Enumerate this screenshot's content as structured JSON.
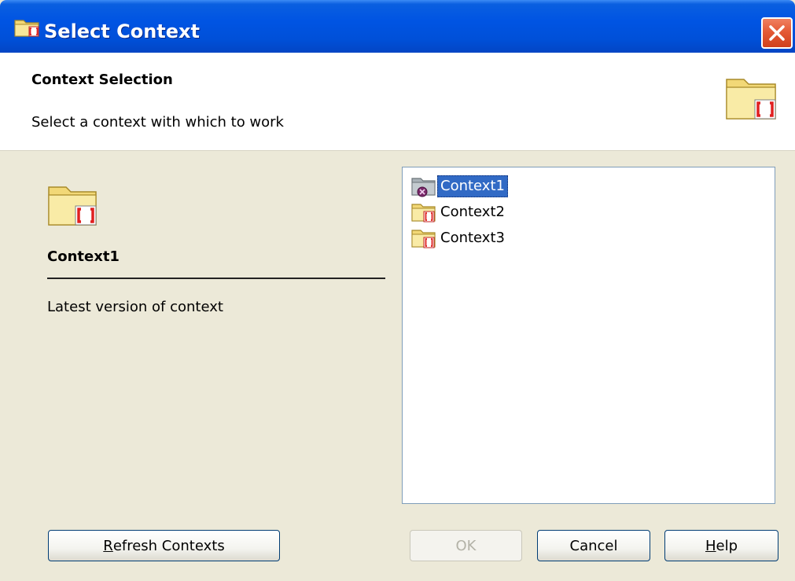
{
  "window": {
    "title": "Select Context",
    "title_icon": "context-folder-icon",
    "close_icon": "close-icon"
  },
  "header": {
    "title": "Context Selection",
    "subtitle": "Select a context with which to work",
    "icon": "context-folder-icon"
  },
  "details": {
    "name": "Context1",
    "description": "Latest version of context",
    "icon": "context-folder-icon"
  },
  "contexts": [
    {
      "label": "Context1",
      "icon": "active-context-folder-icon",
      "selected": true
    },
    {
      "label": "Context2",
      "icon": "context-folder-icon",
      "selected": false
    },
    {
      "label": "Context3",
      "icon": "context-folder-icon",
      "selected": false
    }
  ],
  "buttons": {
    "refresh": {
      "mnemonic": "R",
      "rest": "efresh Contexts"
    },
    "ok": {
      "label": "OK",
      "enabled": false
    },
    "cancel": {
      "label": "Cancel"
    },
    "help": {
      "mnemonic": "H",
      "rest": "elp"
    }
  },
  "colors": {
    "titlebar": "#0054e3",
    "selection": "#316ac5",
    "dialog_bg": "#ece9d8",
    "context_badge": "#e02020"
  }
}
